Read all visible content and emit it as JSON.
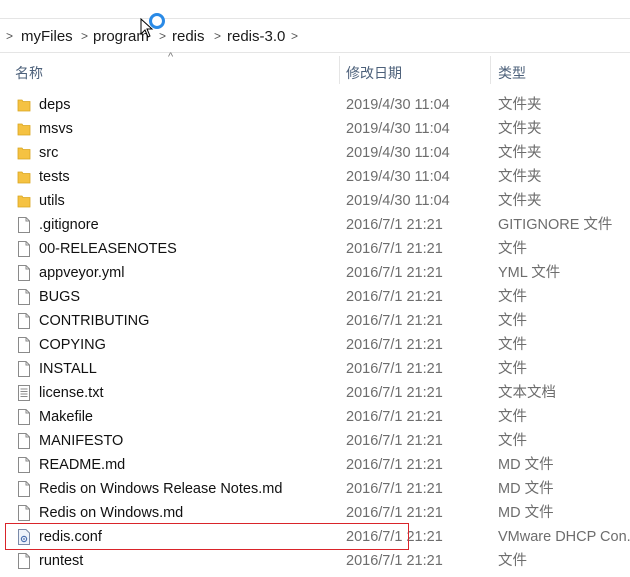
{
  "breadcrumb": {
    "items": [
      "myFiles",
      "programs",
      "redis",
      "redis-3.0"
    ],
    "separators": [
      ">",
      ">",
      ">",
      ">",
      ">"
    ]
  },
  "columns": {
    "name": "名称",
    "date": "修改日期",
    "type": "类型",
    "sort_indicator": "^"
  },
  "files": [
    {
      "name": "deps",
      "date": "2019/4/30 11:04",
      "type": "文件夹",
      "icon": "folder-icon"
    },
    {
      "name": "msvs",
      "date": "2019/4/30 11:04",
      "type": "文件夹",
      "icon": "folder-icon"
    },
    {
      "name": "src",
      "date": "2019/4/30 11:04",
      "type": "文件夹",
      "icon": "folder-icon"
    },
    {
      "name": "tests",
      "date": "2019/4/30 11:04",
      "type": "文件夹",
      "icon": "folder-icon"
    },
    {
      "name": "utils",
      "date": "2019/4/30 11:04",
      "type": "文件夹",
      "icon": "folder-icon"
    },
    {
      "name": ".gitignore",
      "date": "2016/7/1 21:21",
      "type": "GITIGNORE 文件",
      "icon": "file-icon"
    },
    {
      "name": "00-RELEASENOTES",
      "date": "2016/7/1 21:21",
      "type": "文件",
      "icon": "file-icon"
    },
    {
      "name": "appveyor.yml",
      "date": "2016/7/1 21:21",
      "type": "YML 文件",
      "icon": "file-icon"
    },
    {
      "name": "BUGS",
      "date": "2016/7/1 21:21",
      "type": "文件",
      "icon": "file-icon"
    },
    {
      "name": "CONTRIBUTING",
      "date": "2016/7/1 21:21",
      "type": "文件",
      "icon": "file-icon"
    },
    {
      "name": "COPYING",
      "date": "2016/7/1 21:21",
      "type": "文件",
      "icon": "file-icon"
    },
    {
      "name": "INSTALL",
      "date": "2016/7/1 21:21",
      "type": "文件",
      "icon": "file-icon"
    },
    {
      "name": "license.txt",
      "date": "2016/7/1 21:21",
      "type": "文本文档",
      "icon": "text-document-icon"
    },
    {
      "name": "Makefile",
      "date": "2016/7/1 21:21",
      "type": "文件",
      "icon": "file-icon"
    },
    {
      "name": "MANIFESTO",
      "date": "2016/7/1 21:21",
      "type": "文件",
      "icon": "file-icon"
    },
    {
      "name": "README.md",
      "date": "2016/7/1 21:21",
      "type": "MD 文件",
      "icon": "file-icon"
    },
    {
      "name": "Redis on Windows Release Notes.md",
      "date": "2016/7/1 21:21",
      "type": "MD 文件",
      "icon": "file-icon"
    },
    {
      "name": "Redis on Windows.md",
      "date": "2016/7/1 21:21",
      "type": "MD 文件",
      "icon": "file-icon"
    },
    {
      "name": "redis.conf",
      "date": "2016/7/1 21:21",
      "type": "VMware DHCP Con...",
      "icon": "config-file-icon",
      "highlighted": true
    },
    {
      "name": "runtest",
      "date": "2016/7/1 21:21",
      "type": "文件",
      "icon": "file-icon"
    }
  ],
  "colors": {
    "folder": "#f5c242",
    "highlight_border": "#d9242a",
    "spinner": "#2a8ae6"
  }
}
